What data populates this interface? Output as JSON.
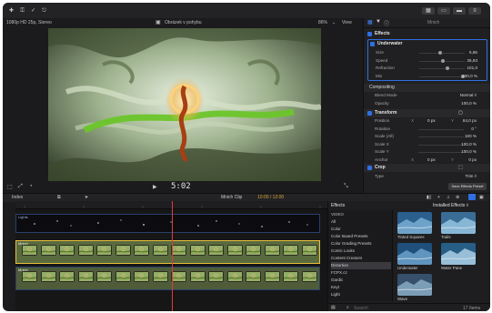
{
  "header": {
    "format": "1080p HD 25p, Stereo",
    "project": "Obrázek v pohybu",
    "zoom": "86%",
    "view": "View",
    "inspector_title": "Mnich"
  },
  "inspector": {
    "effects_label": "Effects",
    "underwater": {
      "name": "Underwater",
      "params": [
        {
          "label": "Size",
          "value": "5,86",
          "level": 0.45
        },
        {
          "label": "Speed",
          "value": "25,93",
          "level": 0.52
        },
        {
          "label": "Refraction",
          "value": "101,0",
          "level": 0.62
        },
        {
          "label": "Mix",
          "value": "100,0 %",
          "level": 1.0
        }
      ]
    },
    "compositing": {
      "name": "Compositing",
      "params": [
        {
          "label": "Blend Mode",
          "value": "Normal ◊"
        },
        {
          "label": "Opacity",
          "value": "100,0 %"
        }
      ]
    },
    "transform": {
      "name": "Transform",
      "params": [
        {
          "label": "Position",
          "x": "0 px",
          "y": "84,0 px"
        },
        {
          "label": "Rotation",
          "value": "0 °"
        },
        {
          "label": "Scale (All)",
          "value": "100 %"
        },
        {
          "label": "Scale X",
          "value": "100,0 %"
        },
        {
          "label": "Scale Y",
          "value": "100,0 %"
        },
        {
          "label": "Anchor",
          "x": "0 px",
          "y": "0 px"
        }
      ]
    },
    "crop": {
      "name": "Crop",
      "type_label": "Type",
      "type_value": "Trim ◊"
    },
    "save_button": "Save Effects Preset"
  },
  "viewer": {
    "timecode": "5:02"
  },
  "timeline": {
    "index_label": "Index",
    "clip_name": "Mnich Clip",
    "clip_time": "10:00 / 12:00",
    "tracks": [
      {
        "label": "Lights",
        "kind": "dark"
      },
      {
        "label": "Mnich",
        "kind": "video",
        "selected": true
      },
      {
        "label": "Mnich",
        "kind": "video",
        "selected": false
      }
    ]
  },
  "effects_browser": {
    "title": "Effects",
    "filter": "Installed Effects ◊",
    "categories": [
      "VIDEO",
      "All",
      "Color",
      "Color Board Presets",
      "Color Grading Presets",
      "Comic Looks",
      "Content Creators",
      "Distortion",
      "FCPX.cz",
      "Gardic",
      "Keyt",
      "Light"
    ],
    "selected_category": "Distortion",
    "items": [
      {
        "name": "Tinted Squares"
      },
      {
        "name": "Trails"
      },
      {
        "name": "Underwater"
      },
      {
        "name": "Water Pane"
      },
      {
        "name": "Wave"
      }
    ],
    "search_placeholder": "Search",
    "count": "17 Items"
  }
}
